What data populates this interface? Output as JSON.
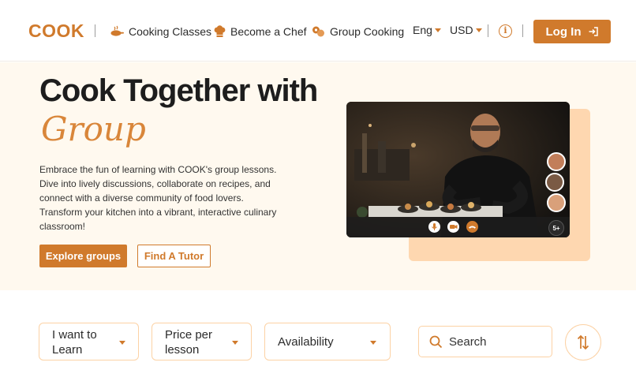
{
  "brand": {
    "logo": "COOK",
    "accent": "#d07a2c"
  },
  "nav": [
    {
      "label": "Cooking Classes",
      "icon": "cooking-pan-icon"
    },
    {
      "label": "Become a Chef",
      "icon": "chef-hat-icon"
    },
    {
      "label": "Group Cooking",
      "icon": "group-cooking-icon"
    }
  ],
  "header": {
    "language": "Eng",
    "currency": "USD",
    "info_icon": "info-icon",
    "login_label": "Log In",
    "login_icon": "login-arrow-icon"
  },
  "hero": {
    "title": "Cook Together with",
    "script_word": "Group",
    "description": "Embrace the fun of learning with COOK's group lessons. Dive into lively discussions, collaborate on recipes, and connect with a diverse community of food lovers. Transform your kitchen into a vibrant, interactive culinary classroom!",
    "primary_button": "Explore groups",
    "secondary_button": "Find A Tutor",
    "video": {
      "participants_more": "5+",
      "controls": [
        "microphone-icon",
        "camera-icon",
        "end-call-icon"
      ]
    }
  },
  "filters": {
    "items": [
      {
        "label": "I want to Learn"
      },
      {
        "label": "Price per lesson"
      },
      {
        "label": "Availability"
      }
    ],
    "search_placeholder": "Search",
    "sort_icon": "sort-arrows-icon"
  }
}
